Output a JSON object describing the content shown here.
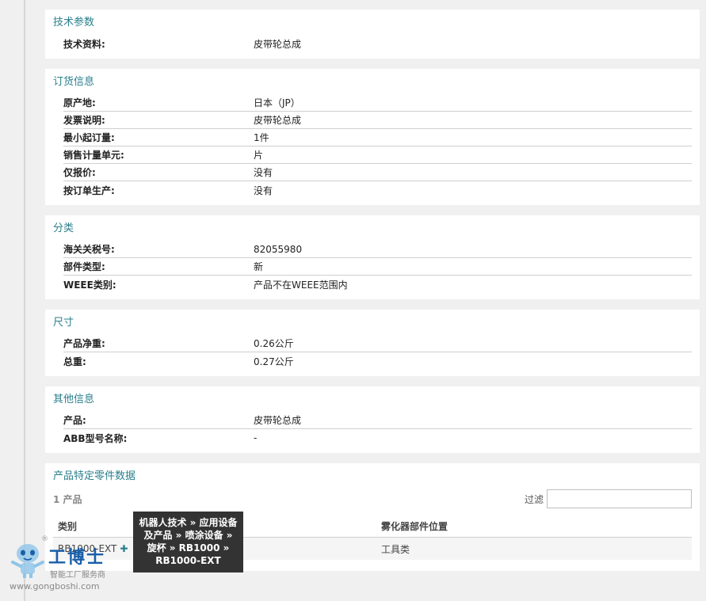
{
  "sections": {
    "tech": {
      "title": "技术参数",
      "rows": [
        {
          "label": "技术资料:",
          "value": "皮带轮总成"
        }
      ]
    },
    "order": {
      "title": "订货信息",
      "rows": [
        {
          "label": "原产地:",
          "value": "日本（JP）"
        },
        {
          "label": "发票说明:",
          "value": "皮带轮总成"
        },
        {
          "label": "最小起订量:",
          "value": "1件"
        },
        {
          "label": "销售计量单元:",
          "value": "片"
        },
        {
          "label": "仅报价:",
          "value": "没有"
        },
        {
          "label": "按订单生产:",
          "value": "没有"
        }
      ]
    },
    "category": {
      "title": "分类",
      "rows": [
        {
          "label": "海关关税号:",
          "value": "82055980"
        },
        {
          "label": "部件类型:",
          "value": "新"
        },
        {
          "label": "WEEE类别:",
          "value": "产品不在WEEE范围内"
        }
      ]
    },
    "dimensions": {
      "title": "尺寸",
      "rows": [
        {
          "label": "产品净重:",
          "value": "0.26公斤"
        },
        {
          "label": "总重:",
          "value": "0.27公斤"
        }
      ]
    },
    "other": {
      "title": "其他信息",
      "rows": [
        {
          "label": "产品:",
          "value": "皮带轮总成"
        },
        {
          "label": "ABB型号名称:",
          "value": "-"
        }
      ]
    }
  },
  "parts": {
    "title": "产品特定零件数据",
    "count": "1 产品",
    "filter_label": "过滤",
    "filter_value": "",
    "columns": [
      "类别",
      "雾化器部件位置"
    ],
    "row": {
      "category": "RB1000-EXT",
      "plus": "✚",
      "location": "工具类"
    }
  },
  "tooltip": {
    "line1": "机器人技术 » 应用设备",
    "line2": "及产品 » 喷涂设备 »",
    "line3": "旋杯 » RB1000 »",
    "line4": "RB1000-EXT"
  },
  "watermark": {
    "reg": "®",
    "name": "工博士",
    "sub": "智能工厂服务商",
    "url": "www.gongboshi.com"
  },
  "colors": {
    "accent": "#2a7f8c",
    "background": "#f0f0f0",
    "tooltip_bg": "#333333"
  }
}
